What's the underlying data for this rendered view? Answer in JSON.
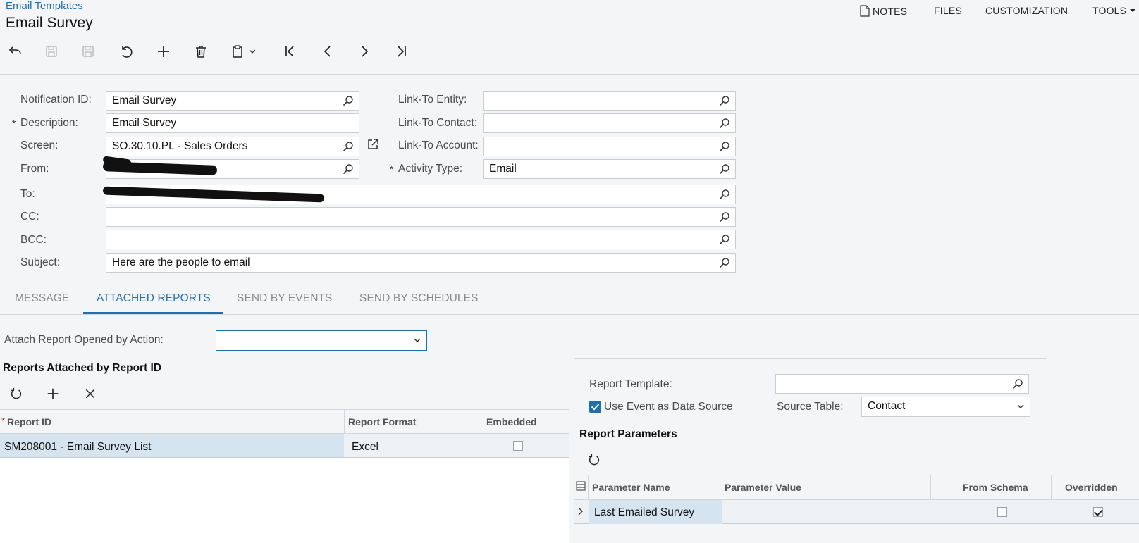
{
  "breadcrumb": "Email Templates",
  "page_title": "Email Survey",
  "top_menu": {
    "notes": "NOTES",
    "files": "FILES",
    "customization": "CUSTOMIZATION",
    "tools": "TOOLS"
  },
  "form": {
    "notification_id": {
      "label": "Notification ID:",
      "value": "Email Survey"
    },
    "description": {
      "label": "Description:",
      "value": "Email Survey",
      "required": "*"
    },
    "screen": {
      "label": "Screen:",
      "value": "SO.30.10.PL - Sales Orders"
    },
    "from": {
      "label": "From:",
      "value": ""
    },
    "to": {
      "label": "To:",
      "value": ""
    },
    "cc": {
      "label": "CC:",
      "value": ""
    },
    "bcc": {
      "label": "BCC:",
      "value": ""
    },
    "subject": {
      "label": "Subject:",
      "value": "Here are the people to email"
    },
    "link_to_entity": {
      "label": "Link-To Entity:",
      "value": ""
    },
    "link_to_contact": {
      "label": "Link-To Contact:",
      "value": ""
    },
    "link_to_account": {
      "label": "Link-To Account:",
      "value": ""
    },
    "activity_type": {
      "label": "Activity Type:",
      "value": "Email",
      "required": "*"
    }
  },
  "tabs": [
    "MESSAGE",
    "ATTACHED REPORTS",
    "SEND BY EVENTS",
    "SEND BY SCHEDULES"
  ],
  "attach_report": {
    "label": "Attach Report Opened by Action:",
    "value": ""
  },
  "reports_grid": {
    "title": "Reports Attached by Report ID",
    "columns": [
      "Report ID",
      "Report Format",
      "Embedded"
    ],
    "required_mark": "*",
    "rows": [
      {
        "report_id": "SM208001 - Email Survey List",
        "format": "Excel",
        "embedded": false
      }
    ]
  },
  "right_panel": {
    "report_template": {
      "label": "Report Template:",
      "value": ""
    },
    "use_event": {
      "label": "Use Event as Data Source",
      "checked": true
    },
    "source_table": {
      "label": "Source Table:",
      "value": "Contact"
    },
    "params_title": "Report Parameters",
    "columns": [
      "Parameter Name",
      "Parameter Value",
      "From Schema",
      "Overridden"
    ],
    "rows": [
      {
        "name": "Last Emailed Survey",
        "value": "",
        "from_schema": false,
        "overridden": true
      }
    ]
  },
  "colors": {
    "accent": "#1f6fae",
    "selected_row": "#d6e4ef"
  }
}
